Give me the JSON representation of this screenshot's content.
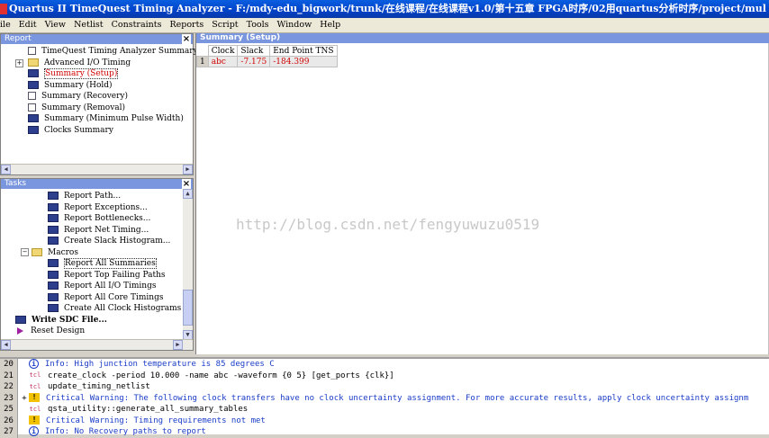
{
  "window": {
    "title": "Quartus II TimeQuest Timing Analyzer - F:/mdy-edu_bigwork/trunk/在线课程/在线课程v1.0/第十五章 FPGA时序/02用quartus分析时序/project/mul - mu"
  },
  "menu": [
    "ile",
    "Edit",
    "View",
    "Netlist",
    "Constraints",
    "Reports",
    "Script",
    "Tools",
    "Window",
    "Help"
  ],
  "report_panel": {
    "header": "Report",
    "items": [
      {
        "label": "TimeQuest Timing Analyzer Summary",
        "icon": "doc-icon"
      },
      {
        "label": "Advanced I/O Timing",
        "icon": "folder-icon",
        "expander": "+"
      },
      {
        "label": "Summary (Setup)",
        "icon": "grid-icon",
        "selected": true
      },
      {
        "label": "Summary (Hold)",
        "icon": "grid-icon"
      },
      {
        "label": "Summary (Recovery)",
        "icon": "doc-icon"
      },
      {
        "label": "Summary (Removal)",
        "icon": "doc-icon"
      },
      {
        "label": "Summary (Minimum Pulse Width)",
        "icon": "grid-icon"
      },
      {
        "label": "Clocks Summary",
        "icon": "grid-icon"
      }
    ]
  },
  "tasks_panel": {
    "header": "Tasks",
    "items": [
      {
        "label": "Report Path...",
        "indent": 2
      },
      {
        "label": "Report Exceptions...",
        "indent": 2
      },
      {
        "label": "Report Bottlenecks...",
        "indent": 2
      },
      {
        "label": "Report Net Timing...",
        "indent": 2
      },
      {
        "label": "Create Slack Histogram...",
        "indent": 2
      },
      {
        "label": "Macros",
        "indent": 1,
        "folder": true,
        "expander": "−"
      },
      {
        "label": "Report All Summaries",
        "indent": 2,
        "selected": true
      },
      {
        "label": "Report Top Failing Paths",
        "indent": 2
      },
      {
        "label": "Report All I/O Timings",
        "indent": 2
      },
      {
        "label": "Report All Core Timings",
        "indent": 2
      },
      {
        "label": "Create All Clock Histograms",
        "indent": 2
      },
      {
        "label": "Write SDC File...",
        "indent": 0,
        "bold": true
      },
      {
        "label": "Reset Design",
        "indent": 0,
        "play": true
      }
    ]
  },
  "summary": {
    "title": "Summary (Setup)",
    "columns": [
      "Clock",
      "Slack",
      "End Point TNS"
    ],
    "rows": [
      {
        "num": "1",
        "clock": "abc",
        "slack": "-7.175",
        "tns": "-184.399"
      }
    ]
  },
  "watermark": "http://blog.csdn.net/fengyuwuzu0519",
  "messages": [
    {
      "num": "20",
      "type": "info",
      "text": "Info: High junction temperature is 85 degrees C"
    },
    {
      "num": "21",
      "type": "tcl",
      "text": "create_clock -period 10.000 -name abc -waveform {0 5} [get_ports {clk}]"
    },
    {
      "num": "22",
      "type": "tcl",
      "text": "update_timing_netlist"
    },
    {
      "num": "23",
      "type": "warn",
      "expander": "+",
      "text": "Critical Warning: The following clock transfers have no clock uncertainty assignment. For more accurate results, apply clock uncertainty assignm"
    },
    {
      "num": "25",
      "type": "tcl",
      "text": "qsta_utility::generate_all_summary_tables"
    },
    {
      "num": "26",
      "type": "warn",
      "text": "Critical Warning: Timing requirements not met"
    },
    {
      "num": "27",
      "type": "info",
      "text": "Info: No Recovery paths to report"
    }
  ],
  "colors": {
    "title_bar": "#0042c8",
    "panel_header": "#7a96df",
    "info_text": "#1a3cc8",
    "selected_text": "#d00000"
  }
}
